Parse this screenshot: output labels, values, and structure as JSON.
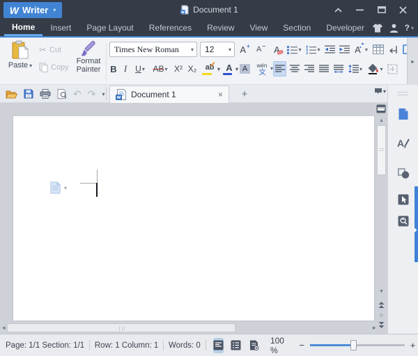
{
  "icons": {
    "dropdown": "▾",
    "up": "▴",
    "down": "▾",
    "left": "◂",
    "right": "▸",
    "cut": "✂",
    "undo": "↶",
    "redo": "↷",
    "close": "×",
    "plus": "+",
    "minus": "−",
    "circle": "○"
  },
  "titlebar": {
    "logo": "W",
    "app_name": "Writer",
    "document_title": "Document 1"
  },
  "menubar": {
    "tabs": [
      {
        "label": "Home",
        "active": true
      },
      {
        "label": "Insert"
      },
      {
        "label": "Page Layout"
      },
      {
        "label": "References"
      },
      {
        "label": "Review"
      },
      {
        "label": "View"
      },
      {
        "label": "Section"
      },
      {
        "label": "Developer"
      }
    ],
    "help_label": "?"
  },
  "ribbon": {
    "paste_label": "Paste",
    "cut_label": "Cut",
    "copy_label": "Copy",
    "format_painter_line1": "Format",
    "format_painter_line2": "Painter",
    "font_name": "Times New Roman",
    "font_size": "12",
    "grow_font_label": "A",
    "shrink_font_label": "A",
    "clear_format_label": "A",
    "bold_label": "B",
    "italic_label": "I",
    "underline_label": "U",
    "strikethrough_label": "AB",
    "superscript_label": "X²",
    "subscript_label": "X₂",
    "highlight_label": "ab",
    "font_color_label": "A",
    "char_shading_label": "A",
    "phonetic_top": "wén",
    "phonetic_bottom": "文"
  },
  "tabbar": {
    "document_tab_label": "Document 1"
  },
  "statusbar": {
    "page_label": "Page: 1/1",
    "section_label": "Section: 1/1",
    "row_column_label": "Row: 1 Column: 1",
    "words_label": "Words: 0",
    "zoom_value": "100 %"
  }
}
